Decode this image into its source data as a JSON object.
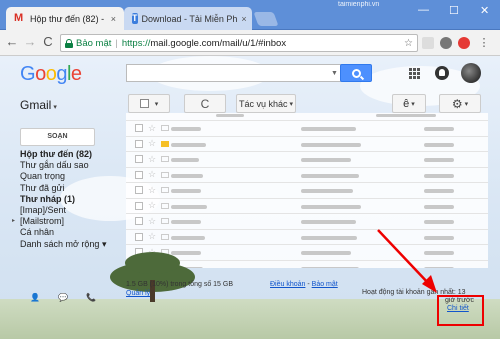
{
  "browser": {
    "tabs": [
      {
        "label": "Hộp thư đến (82) -",
        "icon": "gmail-icon",
        "close": "×"
      },
      {
        "label": "Download - Tải Miễn Ph",
        "icon": "taimienphi-icon",
        "close": "×"
      }
    ],
    "watermark": "taimienphi.vn",
    "window_controls": {
      "min": "—",
      "max": "☐",
      "close": "✕"
    },
    "nav": {
      "back": "←",
      "forward": "→",
      "reload": "C"
    },
    "secure_label": "Bảo mật",
    "url_scheme": "https://",
    "url_rest": "mail.google.com/mail/u/1/#inbox",
    "bookmark_star": "☆"
  },
  "gmail": {
    "logo": [
      "G",
      "o",
      "o",
      "g",
      "l",
      "e"
    ],
    "logo_colors": [
      "#4285f4",
      "#ea4335",
      "#fbbc05",
      "#4285f4",
      "#34a853",
      "#ea4335"
    ],
    "app_label": "Gmail",
    "caret": "▾",
    "toolbar": {
      "refresh": "C",
      "more_actions": "Tác vụ khác",
      "lang": "ê",
      "settings": "⚙"
    },
    "compose": "SOẠN",
    "nav": [
      {
        "label": "Hộp thư đến (82)",
        "bold": true
      },
      {
        "label": "Thư gắn dấu sao",
        "bold": false
      },
      {
        "label": "Quan trọng",
        "bold": false
      },
      {
        "label": "Thư đã gửi",
        "bold": false
      },
      {
        "label": "Thư nháp (1)",
        "bold": true
      },
      {
        "label": "[Imap]/Sent",
        "bold": false
      },
      {
        "label": "[Mailstrom]",
        "bold": false,
        "arrow": "▸"
      },
      {
        "label": "Cá nhân",
        "bold": false
      },
      {
        "label": "Danh sách mở rộng ▾",
        "bold": false
      }
    ],
    "footer": {
      "storage": "1.5 GB (10%) trong tổng số 15 GB",
      "manage": "Quản lý",
      "terms": "Điều khoản",
      "dash": " - ",
      "privacy": "Bảo mật",
      "activity": "Hoạt động tài khoản gần nhất: 13",
      "ago": "giờ trước",
      "details": "Chi tiết"
    }
  }
}
